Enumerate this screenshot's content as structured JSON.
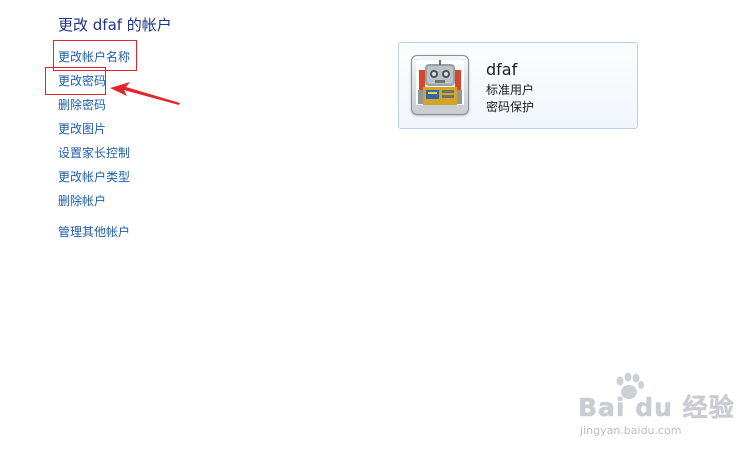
{
  "page": {
    "title": "更改 dfaf 的帐户"
  },
  "tasks": [
    {
      "id": "rename",
      "label": "更改帐户名称"
    },
    {
      "id": "change_password",
      "label": "更改密码"
    },
    {
      "id": "remove_password",
      "label": "删除密码"
    },
    {
      "id": "change_picture",
      "label": "更改图片"
    },
    {
      "id": "parental_controls",
      "label": "设置家长控制"
    },
    {
      "id": "change_account_type",
      "label": "更改帐户类型"
    },
    {
      "id": "delete_account",
      "label": "删除帐户"
    },
    {
      "id": "manage_other",
      "label": "管理其他帐户"
    }
  ],
  "account": {
    "name": "dfaf",
    "type": "标准用户",
    "protection": "密码保护",
    "avatar_icon": "robot-avatar-icon"
  },
  "annotations": {
    "highlight_color": "#e0262b",
    "arrow_icon": "red-arrow-annotation"
  },
  "watermark": {
    "logo": "Bai du 经验",
    "url": "jingyan.baidu.com"
  },
  "colors": {
    "title": "#1e3287",
    "link": "#1f5ea8",
    "card_border": "#b9d1ea"
  }
}
